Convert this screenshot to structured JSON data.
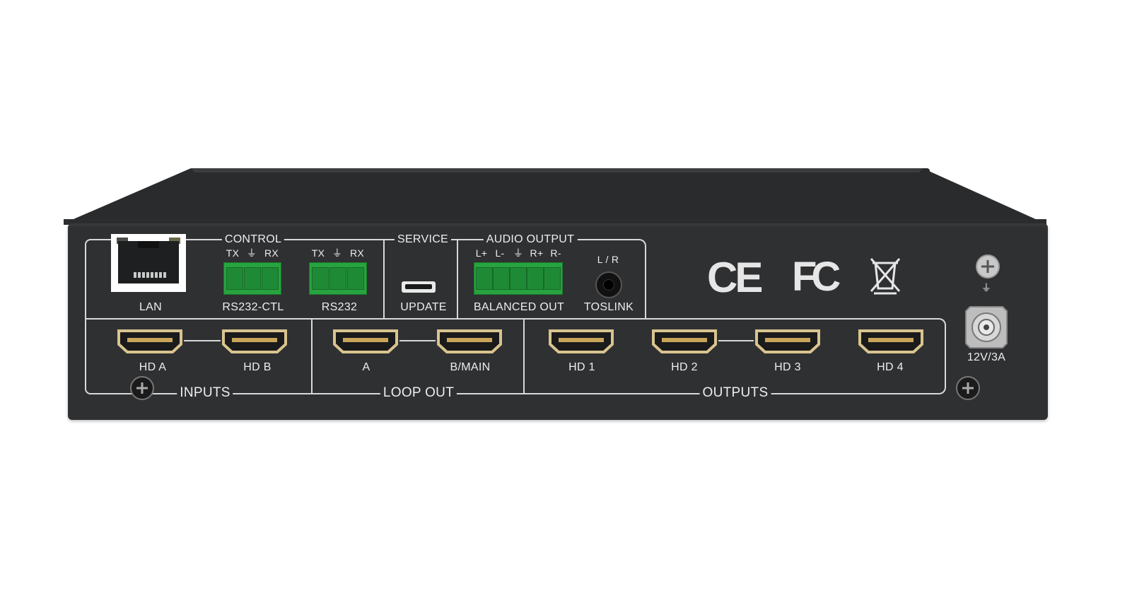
{
  "labels": {
    "control": "CONTROL",
    "service": "SERVICE",
    "audio_output": "AUDIO OUTPUT",
    "lan": "LAN",
    "rs232_ctl": "RS232-CTL",
    "rs232": "RS232",
    "update": "UPDATE",
    "balanced_out": "BALANCED OUT",
    "toslink": "TOSLINK",
    "lr": "L / R",
    "tx": "TX",
    "gnd": "⏚",
    "rx": "RX",
    "l_plus": "L+",
    "l_minus": "L-",
    "r_plus": "R+",
    "r_minus": "R-",
    "hd_a": "HD A",
    "hd_b": "HD B",
    "a": "A",
    "b_main": "B/MAIN",
    "hd1": "HD 1",
    "hd2": "HD 2",
    "hd3": "HD 3",
    "hd4": "HD 4",
    "inputs": "INPUTS",
    "loop_out": "LOOP OUT",
    "outputs": "OUTPUTS",
    "power": "12V/3A",
    "ce": "CE",
    "fc": "FC"
  },
  "colors": {
    "panel": "#2f3032",
    "terminal_green": "#27a33f",
    "hdmi_gold": "#d9c48f",
    "label": "#eeeeee"
  }
}
